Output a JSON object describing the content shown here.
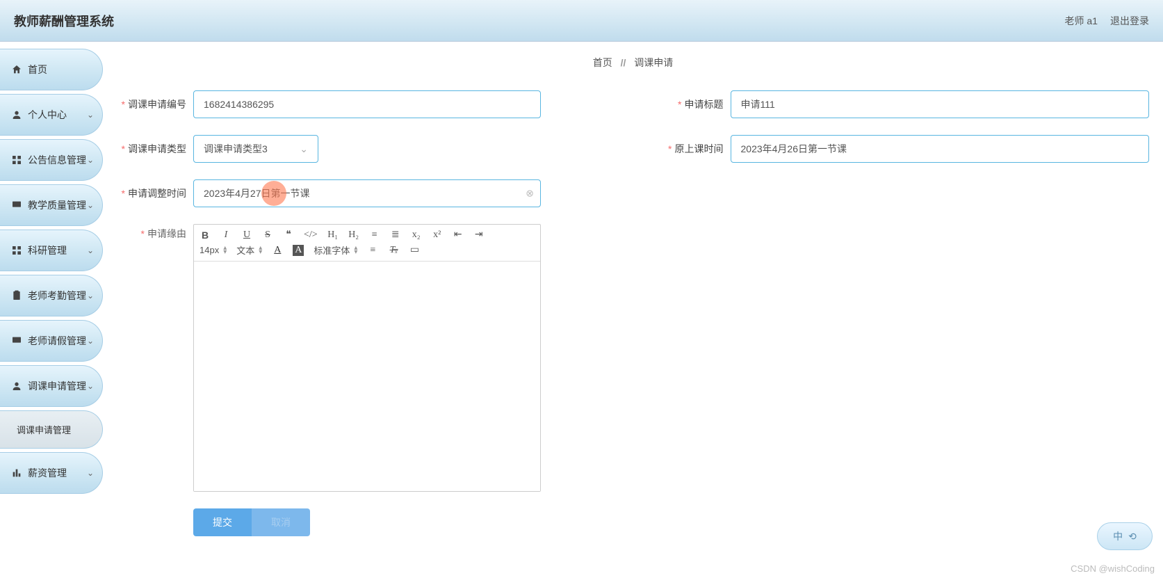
{
  "header": {
    "title": "教师薪酬管理系统",
    "user_prefix": "老师",
    "user_name": "a1",
    "logout": "退出登录"
  },
  "sidebar": {
    "items": [
      {
        "label": "首页",
        "icon": "home",
        "expandable": false
      },
      {
        "label": "个人中心",
        "icon": "user",
        "expandable": true
      },
      {
        "label": "公告信息管理",
        "icon": "grid",
        "expandable": true
      },
      {
        "label": "教学质量管理",
        "icon": "monitor",
        "expandable": true
      },
      {
        "label": "科研管理",
        "icon": "grid",
        "expandable": true
      },
      {
        "label": "老师考勤管理",
        "icon": "clipboard",
        "expandable": true
      },
      {
        "label": "老师请假管理",
        "icon": "monitor",
        "expandable": true
      },
      {
        "label": "调课申请管理",
        "icon": "user",
        "expandable": true
      },
      {
        "label": "调课申请管理",
        "icon": "",
        "expandable": false,
        "sub": true
      },
      {
        "label": "薪资管理",
        "icon": "chart",
        "expandable": true
      }
    ]
  },
  "breadcrumb": {
    "home": "首页",
    "sep": "//",
    "current": "调课申请"
  },
  "form": {
    "app_number_label": "调课申请编号",
    "app_number_value": "1682414386295",
    "title_label": "申请标题",
    "title_value": "申请111",
    "type_label": "调课申请类型",
    "type_value": "调课申请类型3",
    "orig_time_label": "原上课时间",
    "orig_time_value": "2023年4月26日第一节课",
    "adj_time_label": "申请调整时间",
    "adj_time_value": "2023年4月27日第一节课",
    "reason_label": "申请缘由"
  },
  "editor": {
    "font_size": "14px",
    "text_style": "文本",
    "font_family": "标准字体"
  },
  "buttons": {
    "submit": "提交",
    "cancel": "取消"
  },
  "ime": {
    "label": "中"
  },
  "watermark": "CSDN @wishCoding"
}
